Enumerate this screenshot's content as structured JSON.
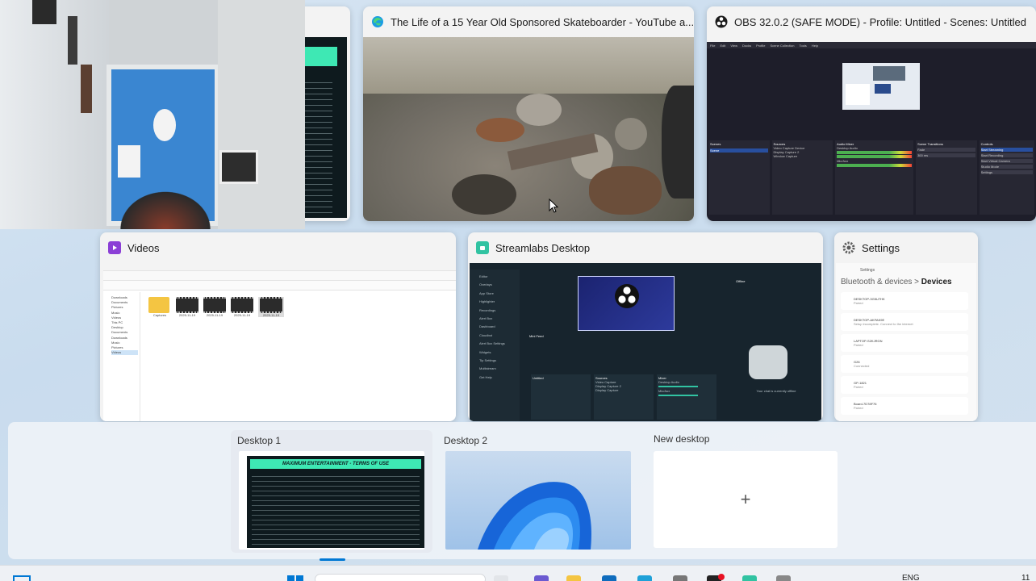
{
  "windows": {
    "partial_card": {},
    "youtube": {
      "title": "The Life of a 15 Year Old Sponsored Skateboarder - YouTube a...",
      "icon": "edge-icon"
    },
    "obs": {
      "title": "OBS 32.0.2 (SAFE MODE) - Profile: Untitled - Scenes: Untitled",
      "icon": "obs-icon",
      "menu": [
        "File",
        "Edit",
        "View",
        "Docks",
        "Profile",
        "Scene Collection",
        "Tools",
        "Help"
      ],
      "panels": [
        "Scenes",
        "Sources",
        "Audio Mixer",
        "Scene Transitions",
        "Controls"
      ],
      "sources": [
        "Video Capture Device",
        "Display Capture 2",
        "Window Capture"
      ],
      "controls": [
        "Start Streaming",
        "Start Recording",
        "Start Virtual Camera",
        "Studio Mode",
        "Settings"
      ],
      "mixer_channels": [
        "Desktop Audio",
        "Mic/Aux"
      ],
      "transition": "Fade",
      "duration": "300 ms",
      "scene": "Scene"
    },
    "videos": {
      "title": "Videos",
      "icon": "folder-videos-icon",
      "nav_items": [
        "Downloads",
        "Documents",
        "Pictures",
        "Music",
        "Videos",
        "This PC",
        "Desktop",
        "Documents",
        "Downloads",
        "Music",
        "Pictures",
        "Videos"
      ],
      "files": [
        "Captures",
        "2025-11-19",
        "2025-11-19",
        "2025-11-19",
        "2025-11-19"
      ]
    },
    "streamlabs": {
      "title": "Streamlabs Desktop",
      "icon": "streamlabs-icon",
      "nav": [
        "Editor",
        "Overlays",
        "App Store",
        "Highlighter",
        "Recordings",
        "Alert Box",
        "Dashboard",
        "Cloudbot",
        "Alert Box Settings",
        "Widgets",
        "Tip Settings",
        "Multistream",
        "Get Help"
      ],
      "mini_feed_label": "Mini Feed",
      "scenes_label": "Untitled",
      "sources_label": "Sources",
      "mixer_label": "Mixer",
      "sources": [
        "Video Capture",
        "Display Capture 2",
        "Display Capture"
      ],
      "mixer": [
        "Desktop Audio",
        "Mic/Aux"
      ],
      "chat_status": "Your chat is currently offline",
      "offline": "Offline"
    },
    "settings": {
      "title": "Settings",
      "icon": "gear-icon",
      "app_label": "Settings",
      "breadcrumb_parent": "Bluetooth & devices",
      "breadcrumb_sep": ">",
      "breadcrumb_current": "Devices",
      "devices": [
        {
          "name": "DESKTOP-3G5U7HK",
          "status": "Paired"
        },
        {
          "name": "DESKTOP-AKFAK9E",
          "status": "Setup incomplete. Connect to the internet"
        },
        {
          "name": "LAPTOP-S2KJRGN",
          "status": "Paired"
        },
        {
          "name": "G26",
          "status": "Connected"
        },
        {
          "name": "GP-1821",
          "status": "Paired"
        },
        {
          "name": "Board-7D78F76",
          "status": "Paired"
        }
      ]
    }
  },
  "desktops": {
    "desktop1": {
      "label": "Desktop 1",
      "banner": "MAXIMUM ENTERTAINMENT - TERMS OF USE"
    },
    "desktop2": {
      "label": "Desktop 2"
    },
    "new": {
      "label": "New desktop",
      "plus": "+"
    }
  },
  "taskbar": {
    "lang": "ENG",
    "clock": "11"
  },
  "colors": {
    "accent": "#0078d4",
    "obs_bg": "#1e1e2a",
    "streamlabs_bg": "#17242d",
    "teal": "#31c3a2",
    "terms_banner": "#3ee8b4"
  }
}
